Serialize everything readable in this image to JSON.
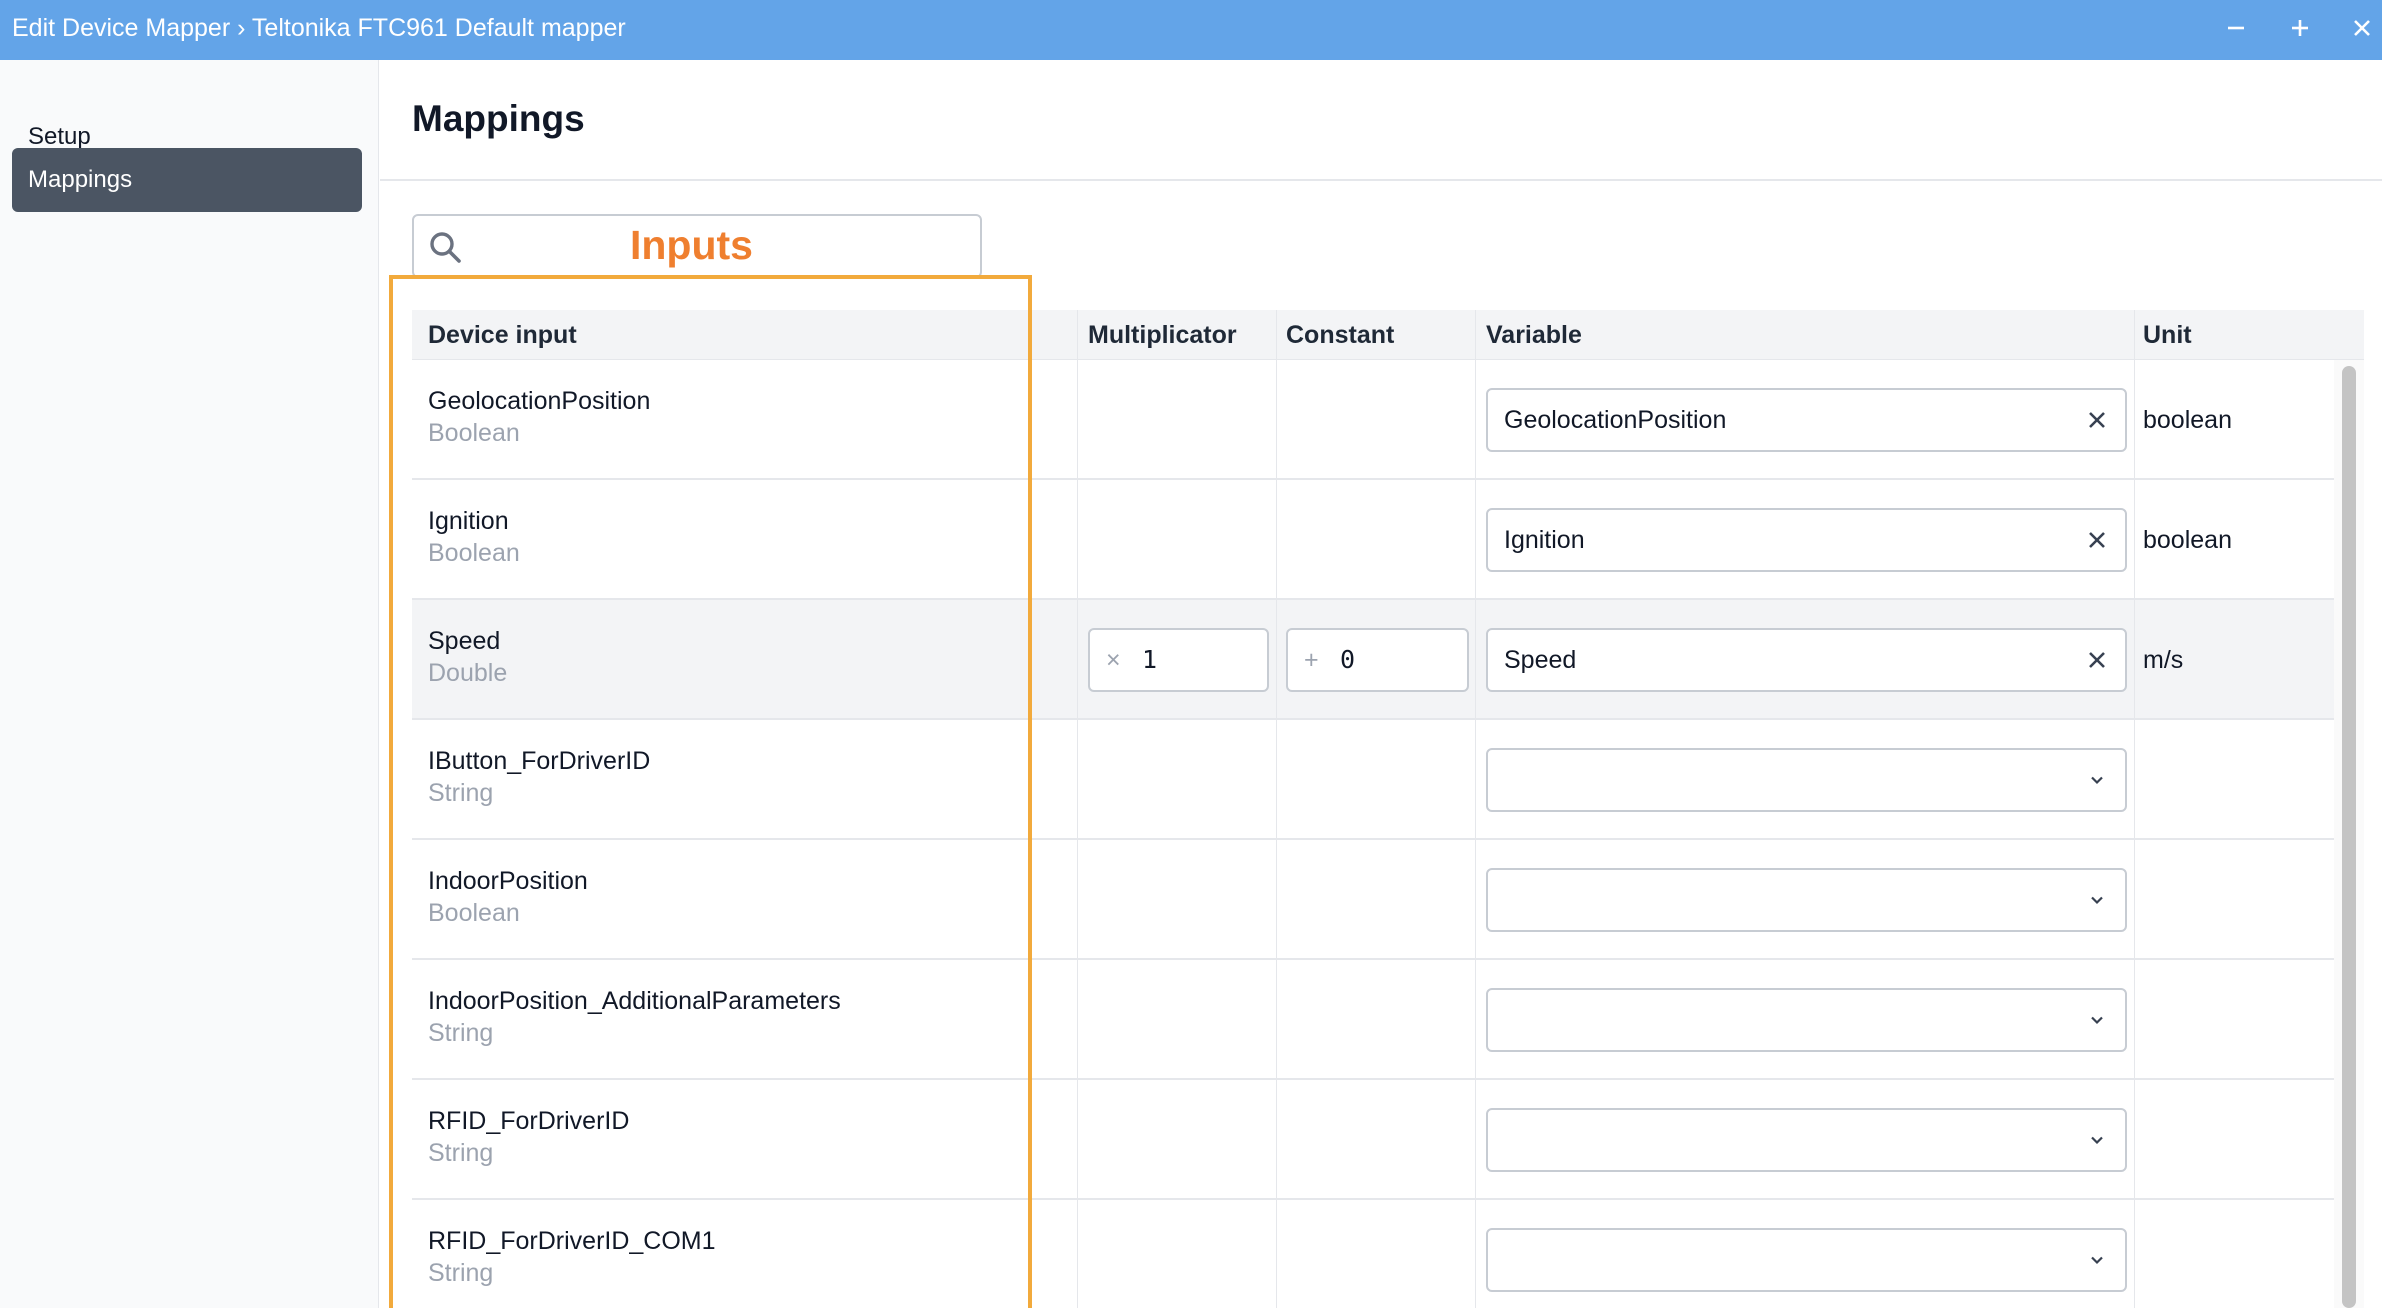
{
  "window": {
    "title": "Edit Device Mapper › Teltonika FTC961 Default mapper",
    "controls": [
      "minimize-icon",
      "maximize-icon",
      "close-icon"
    ]
  },
  "sidebar": {
    "items": [
      {
        "label": "Setup",
        "active": false
      },
      {
        "label": "Mappings",
        "active": true
      }
    ]
  },
  "main": {
    "title": "Mappings",
    "search": {
      "placeholder": "",
      "value": "",
      "icon": "search-icon"
    },
    "annotation": {
      "label": "Inputs",
      "color": "#ef7f2f",
      "box_color": "#f2aa3c"
    }
  },
  "table": {
    "headers": {
      "device_input": "Device input",
      "multiplicator": "Multiplicator",
      "constant": "Constant",
      "variable": "Variable",
      "unit": "Unit"
    },
    "rows": [
      {
        "name": "GeolocationPosition",
        "type": "Boolean",
        "variable": "GeolocationPosition",
        "unit": "boolean"
      },
      {
        "name": "Ignition",
        "type": "Boolean",
        "variable": "Ignition",
        "unit": "boolean"
      },
      {
        "name": "Speed",
        "type": "Double",
        "multiplicator_prefix": "×",
        "multiplicator": "1",
        "constant_prefix": "+",
        "constant": "0",
        "variable": "Speed",
        "unit": "m/s"
      },
      {
        "name": "IButton_ForDriverID",
        "type": "String",
        "variable": ""
      },
      {
        "name": "IndoorPosition",
        "type": "Boolean",
        "variable": ""
      },
      {
        "name": "IndoorPosition_AdditionalParameters",
        "type": "String",
        "variable": ""
      },
      {
        "name": "RFID_ForDriverID",
        "type": "String",
        "variable": ""
      },
      {
        "name": "RFID_ForDriverID_COM1",
        "type": "String",
        "variable": ""
      }
    ]
  },
  "colors": {
    "titlebar": "#63a4e8",
    "sidebar_active": "#4b5563",
    "highlight_row": "#f3f4f6"
  }
}
